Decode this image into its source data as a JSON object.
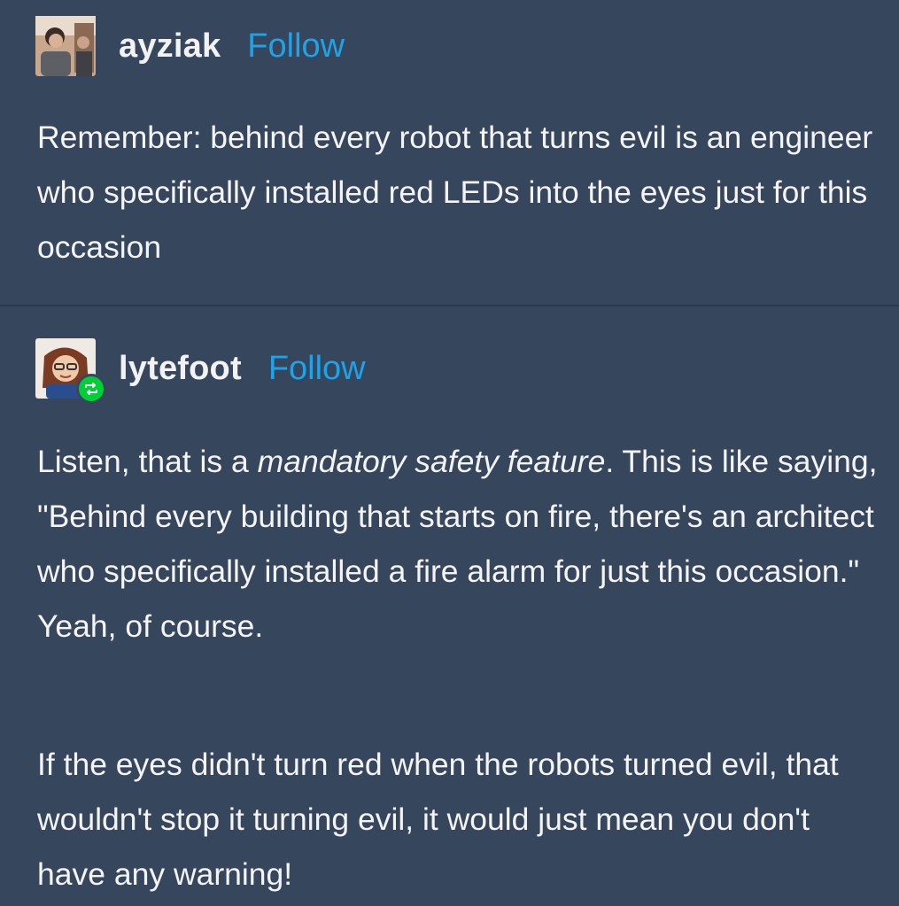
{
  "posts": [
    {
      "username": "ayziak",
      "follow_label": "Follow",
      "avatar_icon": "user-avatar-photo",
      "text": "Remember: behind every robot that turns evil is an engineer who specifically installed red LEDs into the eyes just for this occasion"
    },
    {
      "username": "lytefoot",
      "follow_label": "Follow",
      "avatar_icon": "user-avatar-illustration",
      "badge_icon": "reblog-icon",
      "paragraph1": {
        "before": "Listen, that is a ",
        "emphasis": "mandatory safety feature",
        "after": ". This is like saying, \"Behind every building that starts on fire, there's an architect who specifically installed a fire alarm for just this occasion.\" Yeah, of course."
      },
      "paragraph2": "If the eyes didn't turn red when the robots turned evil, that wouldn't stop it turning evil, it would just mean you don't have any warning!"
    }
  ],
  "colors": {
    "background": "#36465d",
    "follow": "#1ea3e8",
    "reblog_badge": "#00cf35",
    "text": "#f4f4f4"
  }
}
